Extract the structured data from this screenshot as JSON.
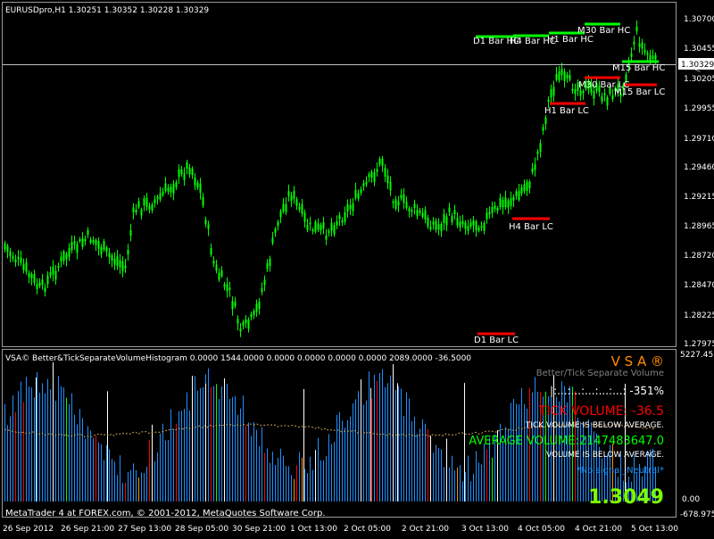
{
  "price_chart": {
    "title": "EURUSDpro,H1  1.30251  1.30352  1.30228  1.30329",
    "price_ticks": [
      "1.30700",
      "1.30455",
      "1.30329",
      "1.30205",
      "1.29955",
      "1.29710",
      "1.29460",
      "1.29215",
      "1.28965",
      "1.28720",
      "1.28470",
      "1.28225",
      "1.27975"
    ],
    "current_price": "1.30329",
    "levels": [
      {
        "label": "D1 Bar HC",
        "color": "#00ff00"
      },
      {
        "label": "H4 Bar HC",
        "color": "#00ff00"
      },
      {
        "label": "H1 Bar HC",
        "color": "#00ff00"
      },
      {
        "label": "M30 Bar HC",
        "color": "#00ff00"
      },
      {
        "label": "M15 Bar HC",
        "color": "#00ff00"
      },
      {
        "label": "M30 Bar LC",
        "color": "#ff0000"
      },
      {
        "label": "M15 Bar LC",
        "color": "#ff0000"
      },
      {
        "label": "H1 Bar LC",
        "color": "#ff0000"
      },
      {
        "label": "H4 Bar LC",
        "color": "#ff0000"
      },
      {
        "label": "D1 Bar LC",
        "color": "#ff0000"
      }
    ],
    "candle_color": "#00ff00"
  },
  "indicator": {
    "title": "VSA© Better&TickSeparateVolumeHistogram  0.0000  1544.0000  0.0000  0.0000  0.0000  0.0000  2089.0000  -36.5000",
    "max_tick": "5227.45",
    "zero_tick": "0.00",
    "min_tick": "-678.975",
    "logo": "V S A ®",
    "subtitle": "Better/Tick Separate Volume",
    "bar_text": "|:...:...:...:...:...:   -351%",
    "tick_volume": "TICK VOLUME: -36.5",
    "tick_volume_note": "TICK VOLUME IS BELOW AVERAGE.",
    "average_volume": "AVERAGE VOLUME:2147483647.0",
    "volume_note": "VOLUME IS BELOW AVERAGE.",
    "signal": "*No signal_Neutral*",
    "price": "1.3049",
    "colors": {
      "blue": "#1e90ff",
      "red": "#ff0000",
      "white": "#ffffff",
      "green": "#00ff00",
      "orange": "#ff8c00",
      "avg": "#c8a25a"
    }
  },
  "footer": {
    "copyright": "MetaTrader 4 at FOREX.com, © 2001-2012, MetaQuotes Software Corp."
  },
  "time_axis": [
    "26 Sep 2012",
    "26 Sep 21:00",
    "27 Sep 13:00",
    "28 Sep 05:00",
    "30 Sep 21:00",
    "1 Oct 13:00",
    "2 Oct 05:00",
    "2 Oct 21:00",
    "3 Oct 13:00",
    "4 Oct 05:00",
    "4 Oct 21:00",
    "5 Oct 13:00"
  ]
}
